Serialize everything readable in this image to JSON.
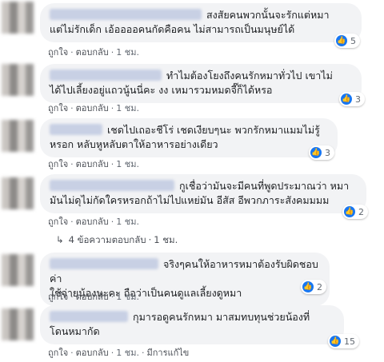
{
  "comments": [
    {
      "text": "สงสัยคนพวกนั้นจะรักแต่หมา\nแต่ไม่รักเด็ก เอ้ออออคนกัดคือคน ไม่สามารถเป็นมนุษย์ได้",
      "likes": "5",
      "actions": {
        "like": "ถูกใจ",
        "reply": "ตอบกลับ",
        "time": "1 ชม."
      }
    },
    {
      "text": "ทำไมต้องโยงถึงคนรักหมาทั่วไป เขาไม่\nได้ไปเลี้ยงอยู่แถวนู้นนี่คะ งง เหมารวมหมดจี๊ก็ได้หรอ",
      "likes": "3",
      "actions": {
        "like": "ถูกใจ",
        "reply": "ตอบกลับ",
        "time": "1 ชม."
      }
    },
    {
      "text": "เชดไปเถอะชีโร่ เชดเงียบๆนะ พวกรักหมาแมมไม่รู้\nหรอก หลับหูหลับตาให้อาหารอย่างเดียว",
      "likes": "3",
      "actions": {
        "like": "ถูกใจ",
        "reply": "ตอบกลับ",
        "time": "1 ชม."
      }
    },
    {
      "text": "กูเชื่อว่ามันจะมีคนที่พูดประมาณว่า หมา\nมันไม่ดุไม่กัดใครหรอกถ้าไม่ไปแหย่มัน อีสัส อีพวกภาระสังคมมมม",
      "likes": "2",
      "actions": {
        "like": "ถูกใจ",
        "reply": "ตอบกลับ",
        "time": "1 ชม."
      },
      "replies": {
        "label": "4 ข้อความตอบกลับ",
        "time": "1 ชม."
      }
    },
    {
      "text": "จริงๆคนให้อาหารหมาต้องรับผิดชอบค่า\nใช้จ่ายน้องนะคะ ถือว่าเป็นคนดูแลเลี้ยงดูหมา",
      "likes": "2",
      "actions": {
        "like": "ถูกใจ",
        "reply": "ตอบกลับ",
        "time": "1 ชม."
      }
    },
    {
      "text": "กุมารอดูคนรักหมา มาสมทบทุนช่วยน้องที่\nโดนหมากัด",
      "likes": "15",
      "actions": {
        "like": "ถูกใจ",
        "reply": "ตอบกลับ",
        "time": "1 ชม.",
        "edited": "มีการแก้ไข"
      }
    }
  ],
  "colors": {
    "like_blue": "#1877f2",
    "bubble_bg": "#f2f3f5"
  }
}
